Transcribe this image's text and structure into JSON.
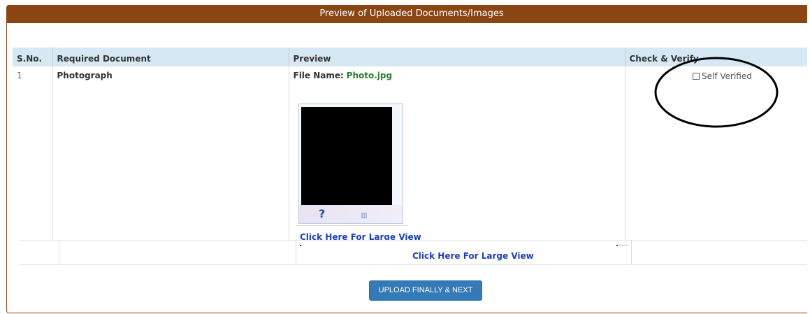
{
  "panel": {
    "title": "Preview of Uploaded Documents/Images"
  },
  "table": {
    "headers": [
      "S.No.",
      "Required Document",
      "Preview",
      "Check & Verify"
    ],
    "rows": [
      {
        "sno": "1",
        "document": "Photograph",
        "file_label": "File Name:",
        "file_name": "Photo.jpg",
        "large_view_link": "Click Here For Large View",
        "verify_label": "Self Verified",
        "verify_checked": false
      }
    ]
  },
  "overlay_row": {
    "large_view_link": "Click Here For Large View"
  },
  "actions": {
    "upload_button": "UPLOAD FINALLY & NEXT"
  },
  "colors": {
    "header_bg": "#8b4513",
    "table_header_bg": "#d6e8f3",
    "file_name": "#2e7d32",
    "link": "#1a3fbf",
    "button": "#337ab7"
  }
}
